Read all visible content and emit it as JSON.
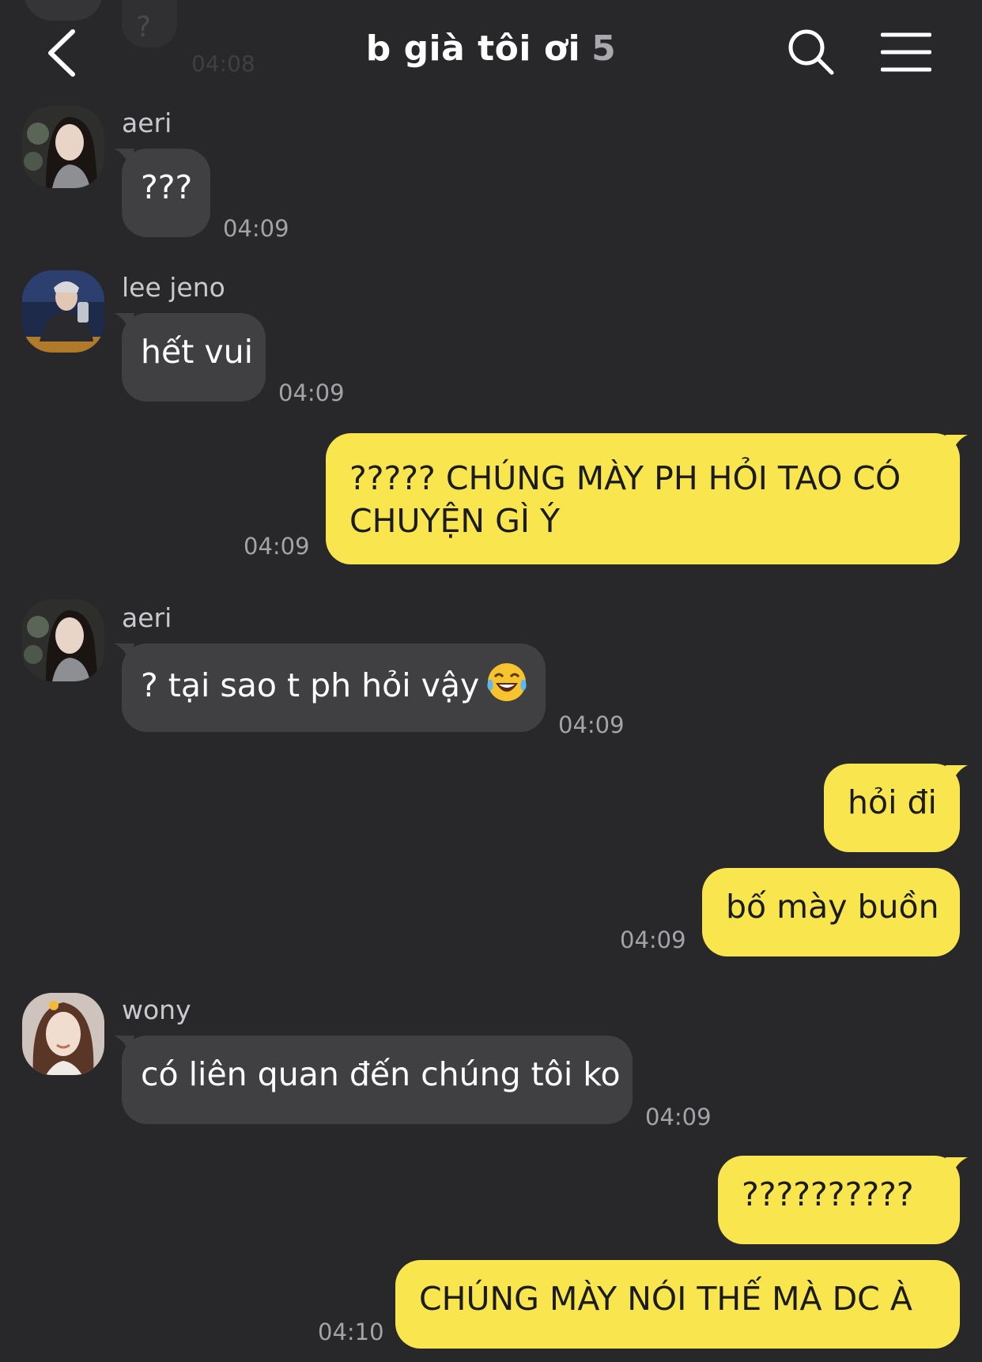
{
  "ghost": {
    "text": "?",
    "time": "04:08"
  },
  "header": {
    "title": "b già tôi ơi",
    "member_count": "5",
    "icons": {
      "back": "chevron-left-icon",
      "search": "search-icon",
      "menu": "hamburger-menu-icon"
    }
  },
  "colors": {
    "background": "#28282b",
    "incoming_bubble": "#404043",
    "outgoing_bubble": "#f9e54e"
  },
  "messages": [
    {
      "sender": "aeri",
      "text": "???",
      "time": "04:09"
    },
    {
      "sender": "lee jeno",
      "text": "hết vui",
      "time": "04:09"
    },
    {
      "line1": "????? CHÚNG MÀY PH HỎI TAO CÓ",
      "line2": "CHUYỆN GÌ Ý",
      "time": "04:09"
    },
    {
      "sender": "aeri",
      "text": "? tại sao t ph hỏi vậy",
      "emoji": "face-with-tears-of-joy",
      "time": "04:09"
    },
    {
      "text": "hỏi đi"
    },
    {
      "text": "bố mày buồn",
      "time": "04:09"
    },
    {
      "sender": "wony",
      "text": "có liên quan đến chúng tôi ko",
      "time": "04:09"
    },
    {
      "text": "??????????"
    },
    {
      "text": "CHÚNG MÀY NÓI THẾ MÀ DC À",
      "time": "04:10"
    }
  ]
}
